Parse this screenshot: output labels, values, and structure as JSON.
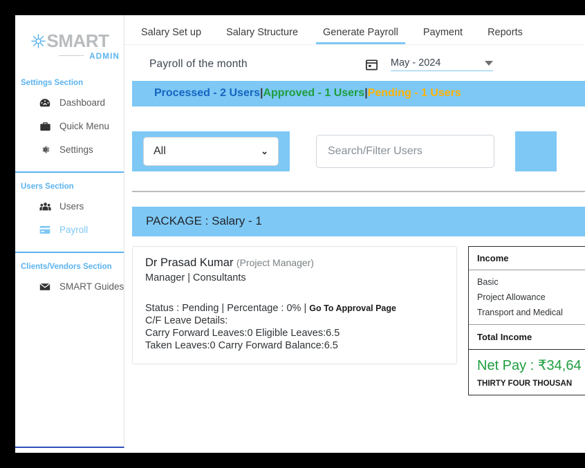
{
  "sidebar": {
    "logo": {
      "mark": "snowflake-icon",
      "name": "SMART",
      "sub": "ADMIN"
    },
    "sections": [
      {
        "title": "Settings Section",
        "items": [
          {
            "label": "Dashboard",
            "icon": "dashboard-icon",
            "active": false
          },
          {
            "label": "Quick Menu",
            "icon": "briefcase-icon",
            "active": false
          },
          {
            "label": "Settings",
            "icon": "gear-icon",
            "active": false
          }
        ]
      },
      {
        "title": "Users Section",
        "items": [
          {
            "label": "Users",
            "icon": "users-icon",
            "active": false
          },
          {
            "label": "Payroll",
            "icon": "card-icon",
            "active": true
          }
        ]
      },
      {
        "title": "Clients/Vendors Section",
        "items": [
          {
            "label": "SMART Guides",
            "icon": "envelope-icon",
            "active": false
          }
        ]
      }
    ]
  },
  "tabs": [
    {
      "label": "Salary Set up",
      "active": false
    },
    {
      "label": "Salary Structure",
      "active": false
    },
    {
      "label": "Generate Payroll",
      "active": true
    },
    {
      "label": "Payment",
      "active": false
    },
    {
      "label": "Reports",
      "active": false
    }
  ],
  "month_row": {
    "title": "Payroll of the month",
    "calendar_icon": "calendar-icon",
    "selected_month": "May - 2024"
  },
  "status_bar": {
    "processed": "Processed - 2 Users",
    "sep1": "|",
    "approved": "Approved - 1 Users",
    "sep2": "|",
    "pending": "Pending - 1 Users",
    "colors": {
      "processed": "#1565c0",
      "approved": "#1e9e3e",
      "pending": "#ffb300",
      "background": "#7ec8f5"
    }
  },
  "filters": {
    "select_value": "All",
    "chevron": "∨",
    "search_placeholder": "Search/Filter Users",
    "search_value": ""
  },
  "package": {
    "header": "PACKAGE : Salary - 1"
  },
  "employee": {
    "name": "Dr Prasad Kumar",
    "role": "(Project Manager)",
    "department": "Manager | Consultants",
    "status_text": "Status : Pending | Percentage : 0% |",
    "approval_link": "Go To Approval Page",
    "cf_label": "C/F Leave Details:",
    "leave_line_1": "Carry Forward Leaves:0   Eligible Leaves:6.5",
    "leave_line_2": "Taken Leaves:0   Carry Forward Balance:6.5"
  },
  "income_panel": {
    "header": "Income",
    "rows": [
      {
        "label": "Basic"
      },
      {
        "label": "Project Allowance"
      },
      {
        "label": "Transport and Medical"
      }
    ],
    "total_label": "Total Income",
    "net_pay": "Net Pay : ₹34,64",
    "net_pay_words": "THIRTY FOUR THOUSAN"
  }
}
